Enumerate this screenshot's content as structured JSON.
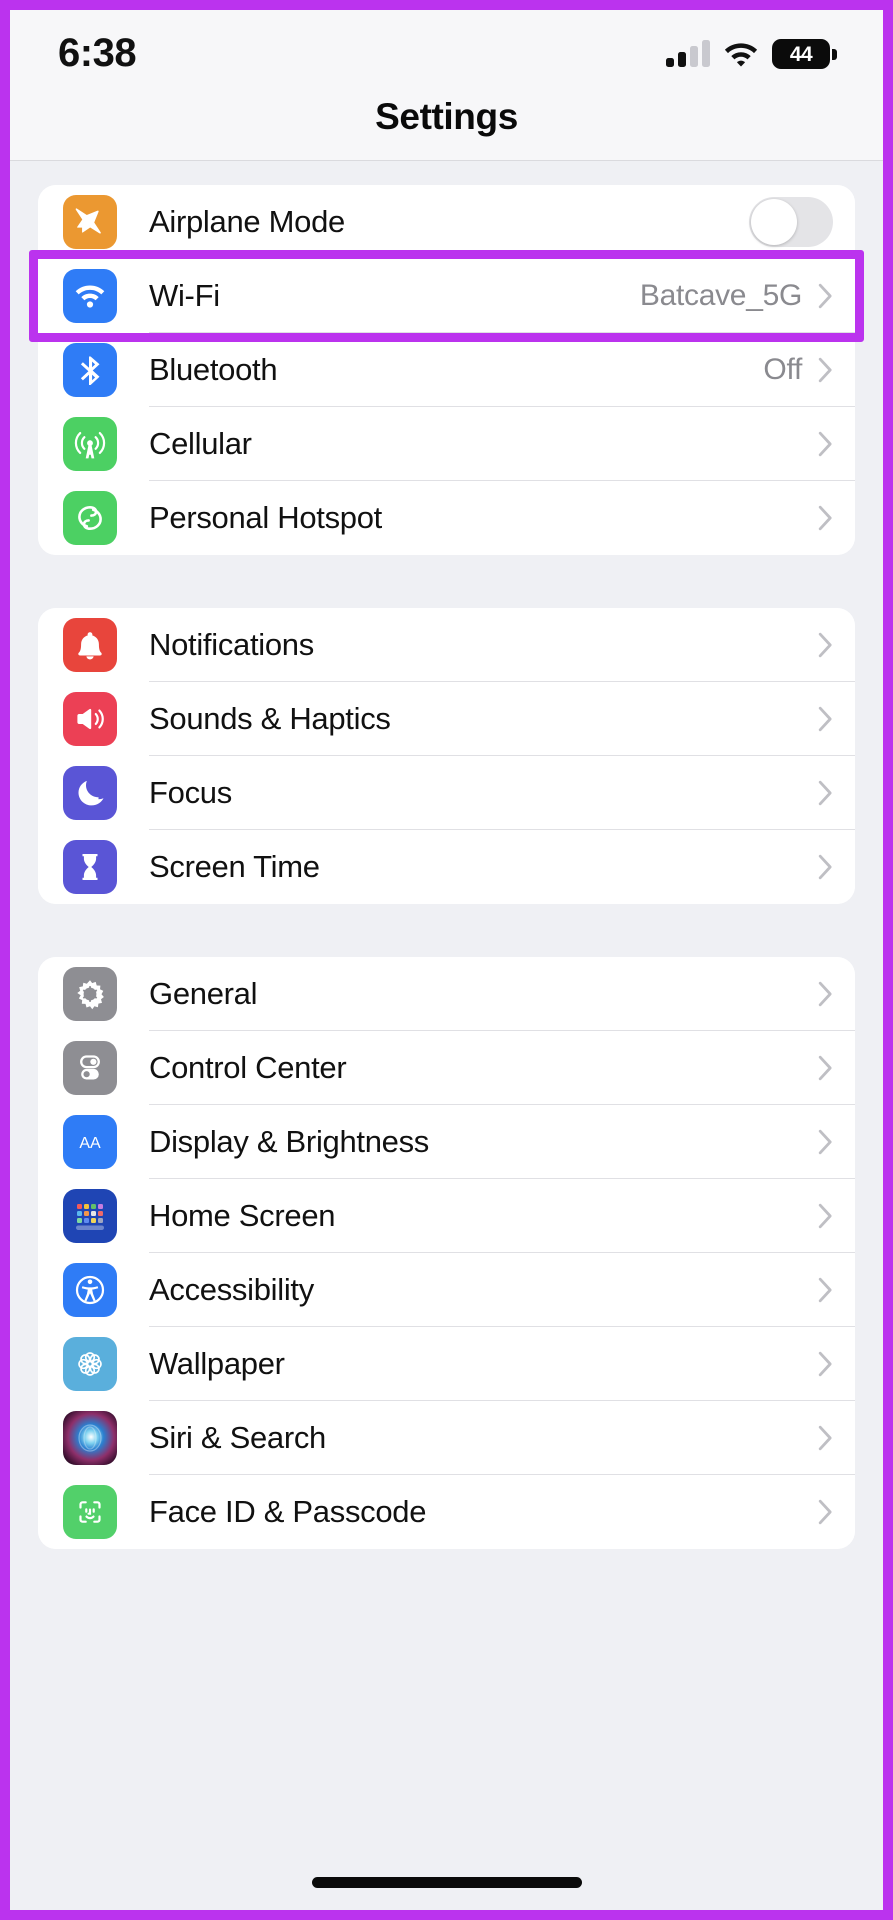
{
  "status_bar": {
    "time": "6:38",
    "cellular_icon": "cellular-signal-icon",
    "wifi_icon": "wifi-icon",
    "battery_level": "44",
    "battery_icon": "battery-icon"
  },
  "header": {
    "title": "Settings"
  },
  "annotation": {
    "highlight_color": "#bb33ee",
    "highlighted_row": "Wi-Fi"
  },
  "groups": [
    {
      "id": "connectivity",
      "rows": [
        {
          "label": "Airplane Mode",
          "value": "",
          "icon": "airplane-icon",
          "icon_class": "bg-orange",
          "control": "toggle",
          "toggle_on": false
        },
        {
          "label": "Wi-Fi",
          "value": "Batcave_5G",
          "icon": "wifi-icon",
          "icon_class": "bg-blue",
          "control": "chevron",
          "highlighted": true
        },
        {
          "label": "Bluetooth",
          "value": "Off",
          "icon": "bluetooth-icon",
          "icon_class": "bg-blue-bt",
          "control": "chevron"
        },
        {
          "label": "Cellular",
          "value": "",
          "icon": "cellular-tower-icon",
          "icon_class": "bg-green",
          "control": "chevron"
        },
        {
          "label": "Personal Hotspot",
          "value": "",
          "icon": "hotspot-link-icon",
          "icon_class": "bg-green2",
          "control": "chevron"
        }
      ]
    },
    {
      "id": "alerts",
      "rows": [
        {
          "label": "Notifications",
          "value": "",
          "icon": "bell-icon",
          "icon_class": "bg-red",
          "control": "chevron"
        },
        {
          "label": "Sounds & Haptics",
          "value": "",
          "icon": "speaker-icon",
          "icon_class": "bg-pink",
          "control": "chevron"
        },
        {
          "label": "Focus",
          "value": "",
          "icon": "moon-icon",
          "icon_class": "bg-indigo",
          "control": "chevron"
        },
        {
          "label": "Screen Time",
          "value": "",
          "icon": "hourglass-icon",
          "icon_class": "bg-indigo",
          "control": "chevron"
        }
      ]
    },
    {
      "id": "system",
      "rows": [
        {
          "label": "General",
          "value": "",
          "icon": "gear-icon",
          "icon_class": "bg-gray",
          "control": "chevron"
        },
        {
          "label": "Control Center",
          "value": "",
          "icon": "toggles-icon",
          "icon_class": "bg-gray",
          "control": "chevron"
        },
        {
          "label": "Display & Brightness",
          "value": "",
          "icon": "text-size-icon",
          "icon_class": "bg-blue",
          "control": "chevron"
        },
        {
          "label": "Home Screen",
          "value": "",
          "icon": "app-grid-icon",
          "icon_class": "bg-homescr",
          "control": "chevron"
        },
        {
          "label": "Accessibility",
          "value": "",
          "icon": "accessibility-icon",
          "icon_class": "bg-blue",
          "control": "chevron"
        },
        {
          "label": "Wallpaper",
          "value": "",
          "icon": "flower-icon",
          "icon_class": "bg-lightblue",
          "control": "chevron"
        },
        {
          "label": "Siri & Search",
          "value": "",
          "icon": "siri-orb-icon",
          "icon_class": "bg-siri",
          "control": "chevron"
        },
        {
          "label": "Face ID & Passcode",
          "value": "",
          "icon": "face-id-icon",
          "icon_class": "bg-facegreen",
          "control": "chevron"
        }
      ]
    }
  ]
}
